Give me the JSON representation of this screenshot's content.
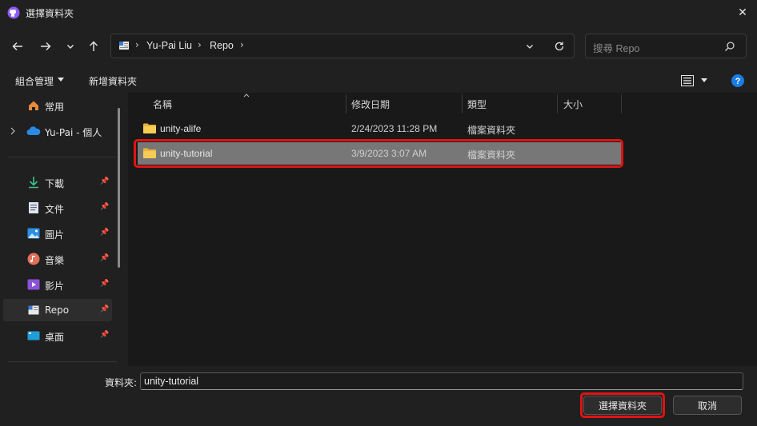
{
  "window": {
    "title": "選擇資料夾",
    "close_glyph": "✕"
  },
  "nav": {
    "back": "←",
    "forward": "→",
    "recent": "⌄",
    "up": "↑"
  },
  "address": {
    "crumbs": [
      "Yu-Pai Liu",
      "Repo"
    ],
    "separator": "›",
    "dropdown_glyph": "⌄",
    "refresh_glyph": "↻"
  },
  "search": {
    "placeholder": "搜尋 Repo"
  },
  "toolbar": {
    "organize": "組合管理",
    "new_folder": "新增資料夾"
  },
  "sidebar": {
    "items": [
      {
        "label": "常用",
        "icon": "home-icon"
      },
      {
        "label": "Yu-Pai - 個人",
        "icon": "onedrive-cloud-icon"
      },
      {
        "label": "下載",
        "icon": "download-icon",
        "pinned": true
      },
      {
        "label": "文件",
        "icon": "document-icon",
        "pinned": true
      },
      {
        "label": "圖片",
        "icon": "pictures-icon",
        "pinned": true
      },
      {
        "label": "音樂",
        "icon": "music-icon",
        "pinned": true
      },
      {
        "label": "影片",
        "icon": "video-icon",
        "pinned": true
      },
      {
        "label": "Repo",
        "icon": "folder-icon",
        "pinned": true,
        "active": true
      },
      {
        "label": "桌面",
        "icon": "desktop-icon",
        "pinned": true
      }
    ],
    "pin_glyph": "📌"
  },
  "columns": {
    "name": "名稱",
    "modified": "修改日期",
    "type": "類型",
    "size": "大小"
  },
  "files": [
    {
      "name": "unity-alife",
      "modified": "2/24/2023 11:28 PM",
      "type": "檔案資料夾",
      "selected": false
    },
    {
      "name": "unity-tutorial",
      "modified": "3/9/2023 3:07 AM",
      "type": "檔案資料夾",
      "selected": true
    }
  ],
  "folder_field": {
    "label": "資料夾:",
    "value": "unity-tutorial"
  },
  "buttons": {
    "select": "選擇資料夾",
    "cancel": "取消"
  },
  "colors": {
    "highlight": "#e01313",
    "selected_row": "#777777",
    "background": "#202020"
  }
}
